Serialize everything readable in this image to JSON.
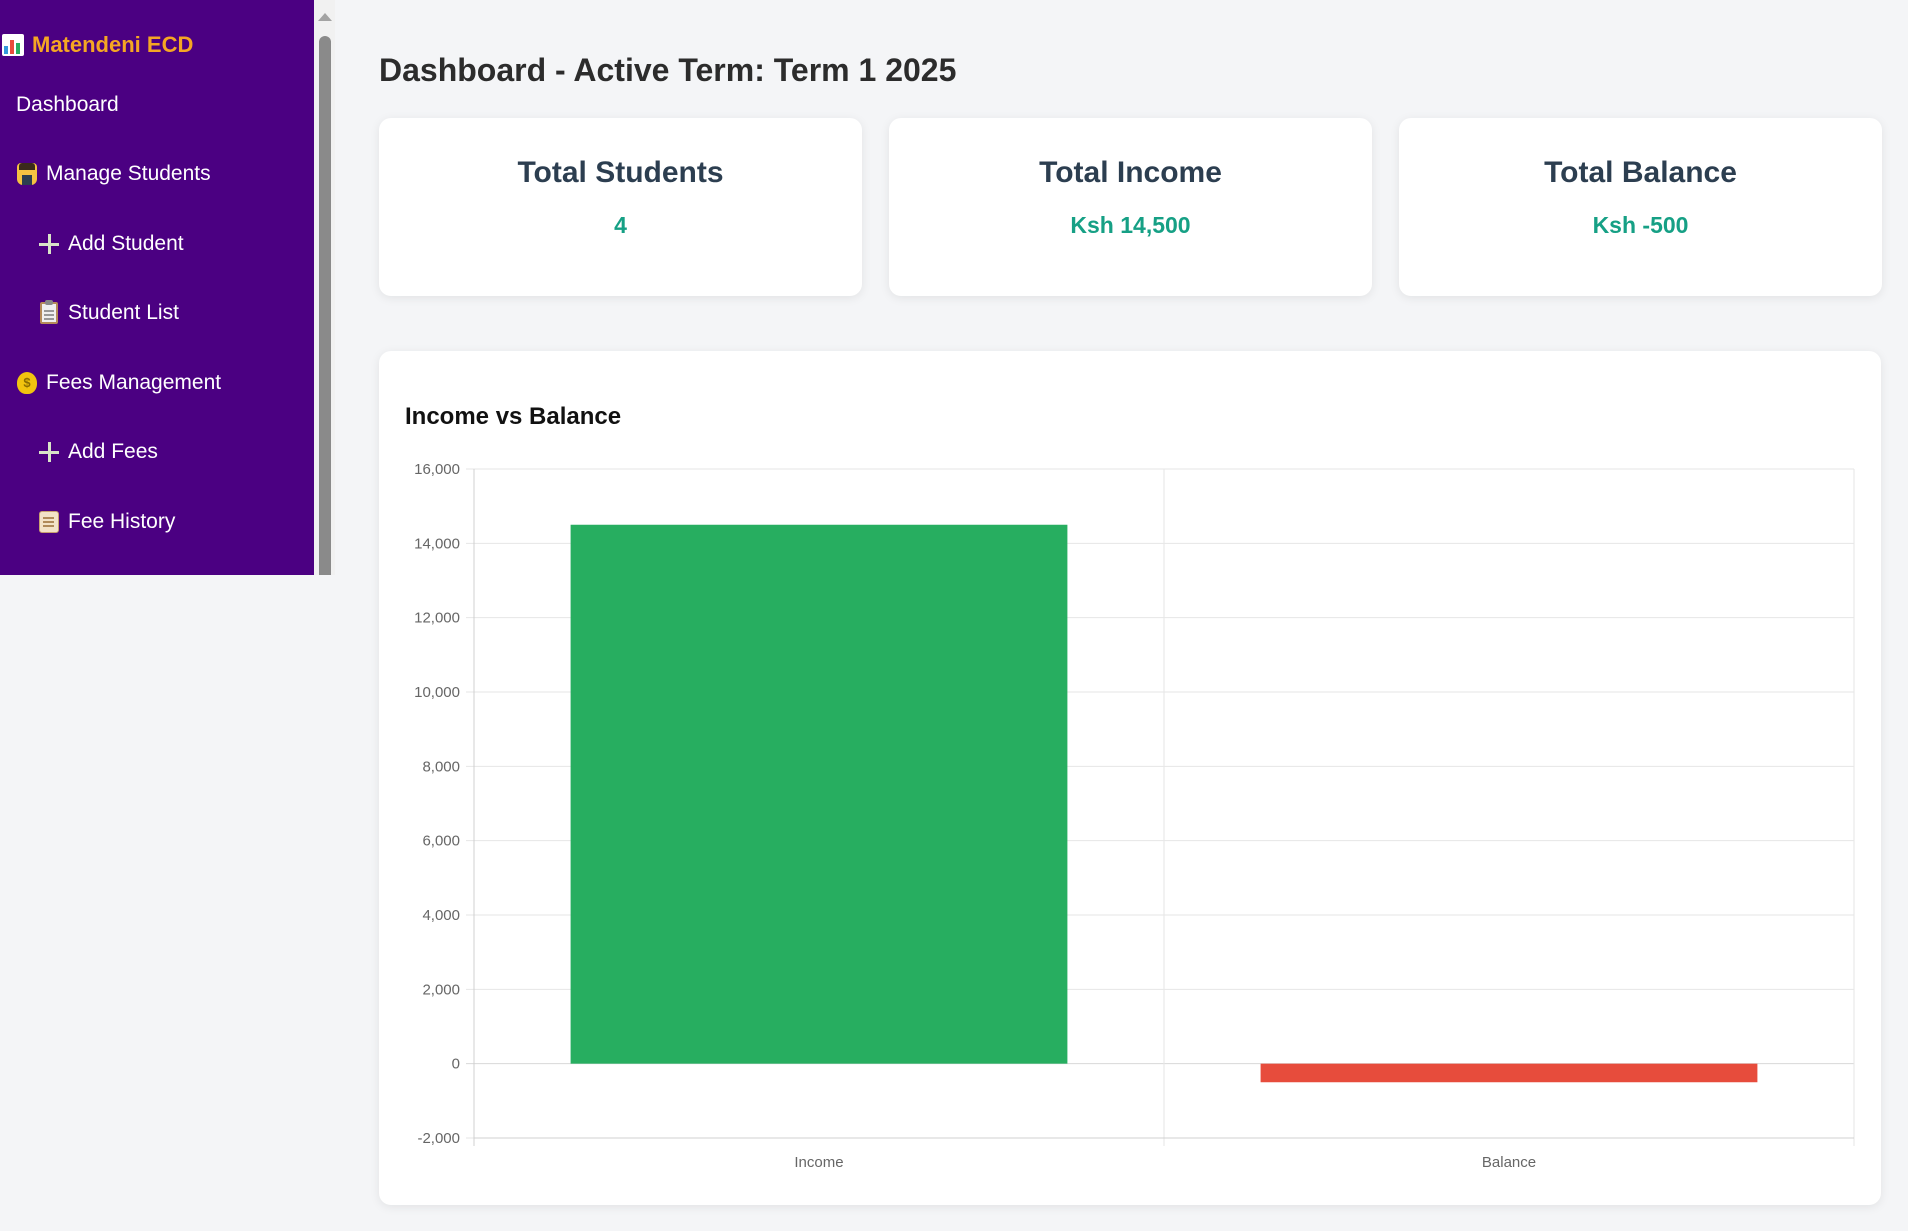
{
  "sidebar": {
    "brand": "Matendeni ECD",
    "brand_icon": "bar-chart-icon",
    "items": [
      {
        "label": "Dashboard",
        "icon": "",
        "sub": false
      },
      {
        "label": "Manage Students",
        "icon": "student-icon",
        "sub": false
      },
      {
        "label": "Add Student",
        "icon": "plus-icon",
        "sub": true
      },
      {
        "label": "Student List",
        "icon": "clipboard-icon",
        "sub": true
      },
      {
        "label": "Fees Management",
        "icon": "money-bag-icon",
        "sub": false
      },
      {
        "label": "Add Fees",
        "icon": "plus-icon",
        "sub": true
      },
      {
        "label": "Fee History",
        "icon": "scroll-icon",
        "sub": true
      }
    ]
  },
  "page": {
    "title": "Dashboard - Active Term: Term 1 2025"
  },
  "cards": [
    {
      "title": "Total Students",
      "value": "4"
    },
    {
      "title": "Total Income",
      "value": "Ksh 14,500"
    },
    {
      "title": "Total Balance",
      "value": "Ksh -500"
    }
  ],
  "colors": {
    "sidebar_bg": "#4b0082",
    "brand": "#f5a623",
    "card_value": "#16a085",
    "income_bar": "#27ae60",
    "balance_bar": "#e74c3c"
  },
  "chart_data": {
    "type": "bar",
    "title": "Income vs Balance",
    "categories": [
      "Income",
      "Balance"
    ],
    "values": [
      14500,
      -500
    ],
    "colors": [
      "#27ae60",
      "#e74c3c"
    ],
    "ylim": [
      -2000,
      16000
    ],
    "yticks": [
      16000,
      14000,
      12000,
      10000,
      8000,
      6000,
      4000,
      2000,
      0,
      -2000
    ],
    "ytick_labels": [
      "16,000",
      "14,000",
      "12,000",
      "10,000",
      "8,000",
      "6,000",
      "4,000",
      "2,000",
      "0",
      "-2,000"
    ],
    "grid": true,
    "legend": false
  }
}
